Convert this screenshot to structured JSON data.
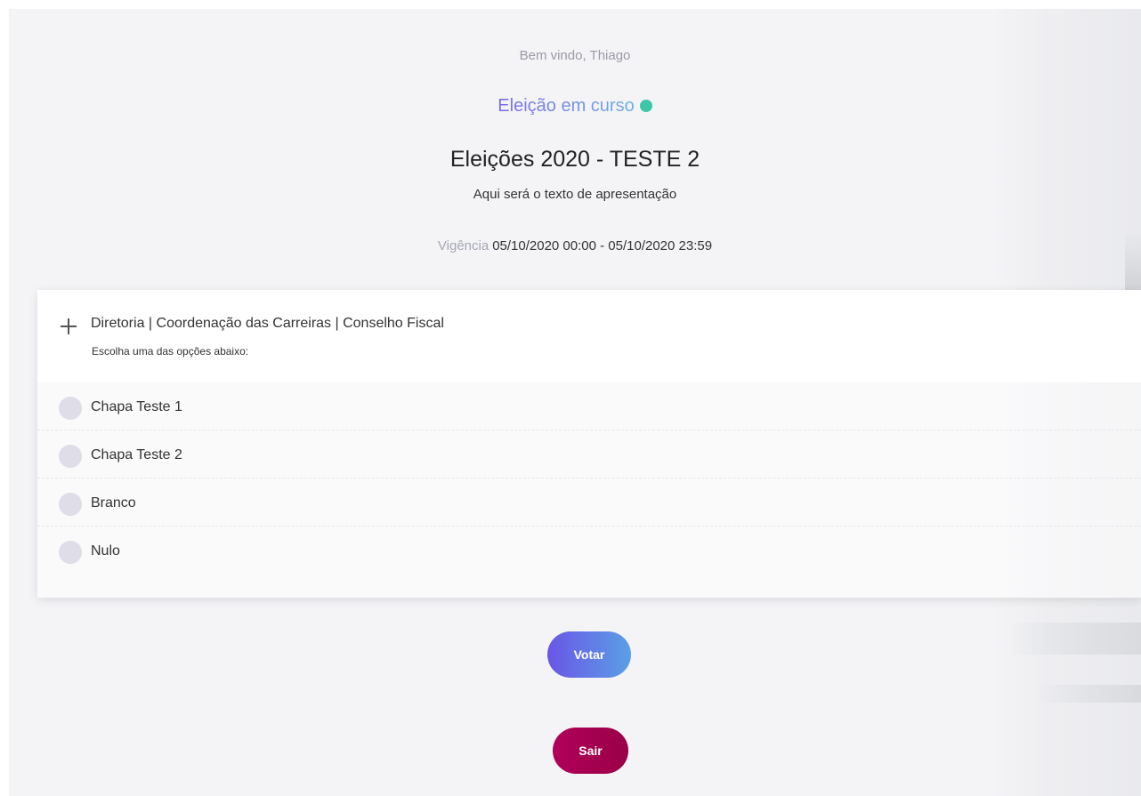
{
  "header": {
    "welcome": "Bem vindo, Thiago",
    "status_text": "Eleição em curso",
    "status_color": "#3cc8a7",
    "title": "Eleições 2020 - TESTE 2",
    "subtitle": "Aqui será o texto de apresentação",
    "validity_label": "Vigência",
    "validity_value": "05/10/2020 00:00 - 05/10/2020 23:59"
  },
  "ballot": {
    "title": "Diretoria | Coordenação das Carreiras | Conselho Fiscal",
    "instruction": "Escolha uma das opções abaixo:",
    "options": [
      {
        "label": "Chapa Teste 1"
      },
      {
        "label": "Chapa Teste 2"
      },
      {
        "label": "Branco"
      },
      {
        "label": "Nulo"
      }
    ]
  },
  "actions": {
    "vote_label": "Votar",
    "exit_label": "Sair"
  },
  "colors": {
    "vote_gradient": [
      "#6a56e6",
      "#5b9fe6"
    ],
    "exit": "#a8004f",
    "radio": "#dedde8"
  }
}
